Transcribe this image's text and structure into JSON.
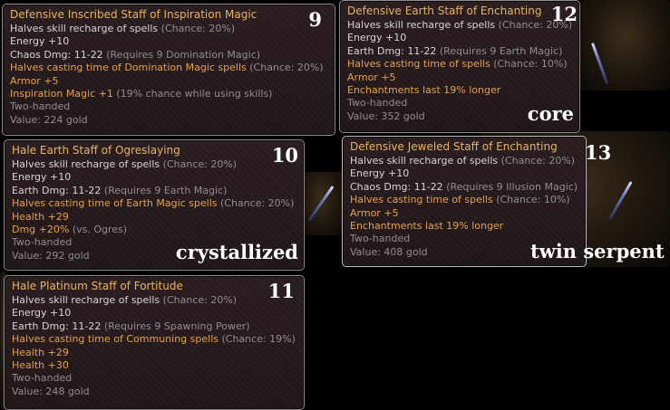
{
  "tooltips": [
    {
      "number": "9",
      "caption": "",
      "lines": [
        {
          "parts": [
            {
              "text": "Defensive Inscribed Staff of Inspiration Magic",
              "color": "title"
            }
          ]
        },
        {
          "parts": [
            {
              "text": "Halves skill recharge of spells ",
              "color": "white"
            },
            {
              "text": "(Chance: 20%)",
              "color": "grey"
            }
          ]
        },
        {
          "parts": [
            {
              "text": "Energy +10",
              "color": "white"
            }
          ]
        },
        {
          "parts": [
            {
              "text": "Chaos Dmg: 11-22 ",
              "color": "white"
            },
            {
              "text": "(Requires 9 Domination Magic)",
              "color": "grey"
            }
          ]
        },
        {
          "parts": [
            {
              "text": "Halves casting time of Domination Magic spells ",
              "color": "orange"
            },
            {
              "text": "(Chance: 20%)",
              "color": "grey"
            }
          ]
        },
        {
          "parts": [
            {
              "text": "Armor +5",
              "color": "orange"
            }
          ]
        },
        {
          "parts": [
            {
              "text": "Inspiration Magic +1 ",
              "color": "orange"
            },
            {
              "text": "(19% chance while using skills)",
              "color": "grey"
            }
          ]
        },
        {
          "parts": [
            {
              "text": "Two-handed",
              "color": "grey"
            }
          ]
        },
        {
          "parts": [
            {
              "text": "Value: 224 gold",
              "color": "grey"
            }
          ]
        }
      ]
    },
    {
      "number": "10",
      "caption": "crystallized",
      "lines": [
        {
          "parts": [
            {
              "text": "Hale Earth Staff of Ogreslaying",
              "color": "title"
            }
          ]
        },
        {
          "parts": [
            {
              "text": "Halves skill recharge of spells ",
              "color": "white"
            },
            {
              "text": "(Chance: 20%)",
              "color": "grey"
            }
          ]
        },
        {
          "parts": [
            {
              "text": "Energy +10",
              "color": "white"
            }
          ]
        },
        {
          "parts": [
            {
              "text": "Earth Dmg: 11-22 ",
              "color": "white"
            },
            {
              "text": "(Requires 9 Earth Magic)",
              "color": "grey"
            }
          ]
        },
        {
          "parts": [
            {
              "text": "Halves casting time of Earth Magic spells ",
              "color": "orange"
            },
            {
              "text": "(Chance: 20%)",
              "color": "grey"
            }
          ]
        },
        {
          "parts": [
            {
              "text": "Health +29",
              "color": "orange"
            }
          ]
        },
        {
          "parts": [
            {
              "text": "Dmg +20% ",
              "color": "orange"
            },
            {
              "text": "(vs. Ogres)",
              "color": "grey"
            }
          ]
        },
        {
          "parts": [
            {
              "text": "Two-handed",
              "color": "grey"
            }
          ]
        },
        {
          "parts": [
            {
              "text": "Value: 292 gold",
              "color": "grey"
            }
          ]
        }
      ]
    },
    {
      "number": "11",
      "caption": "",
      "lines": [
        {
          "parts": [
            {
              "text": "Hale Platinum Staff of Fortitude",
              "color": "title"
            }
          ]
        },
        {
          "parts": [
            {
              "text": "Halves skill recharge of spells ",
              "color": "white"
            },
            {
              "text": "(Chance: 20%)",
              "color": "grey"
            }
          ]
        },
        {
          "parts": [
            {
              "text": "Energy +10",
              "color": "white"
            }
          ]
        },
        {
          "parts": [
            {
              "text": "Earth Dmg: 11-22 ",
              "color": "white"
            },
            {
              "text": "(Requires 9 Spawning Power)",
              "color": "grey"
            }
          ]
        },
        {
          "parts": [
            {
              "text": "Halves casting time of Communing spells ",
              "color": "orange"
            },
            {
              "text": "(Chance: 19%)",
              "color": "grey"
            }
          ]
        },
        {
          "parts": [
            {
              "text": "Health +29",
              "color": "orange"
            }
          ]
        },
        {
          "parts": [
            {
              "text": "Health +30",
              "color": "orange"
            }
          ]
        },
        {
          "parts": [
            {
              "text": "Two-handed",
              "color": "grey"
            }
          ]
        },
        {
          "parts": [
            {
              "text": "Value: 248 gold",
              "color": "grey"
            }
          ]
        }
      ]
    },
    {
      "number": "12",
      "caption": "core",
      "lines": [
        {
          "parts": [
            {
              "text": "Defensive Earth Staff of Enchanting",
              "color": "title"
            }
          ]
        },
        {
          "parts": [
            {
              "text": "Halves skill recharge of spells ",
              "color": "white"
            },
            {
              "text": "(Chance: 20%)",
              "color": "grey"
            }
          ]
        },
        {
          "parts": [
            {
              "text": "Energy +10",
              "color": "white"
            }
          ]
        },
        {
          "parts": [
            {
              "text": "Earth Dmg: 11-22 ",
              "color": "white"
            },
            {
              "text": "(Requires 9 Earth Magic)",
              "color": "grey"
            }
          ]
        },
        {
          "parts": [
            {
              "text": "Halves casting time of spells ",
              "color": "orange"
            },
            {
              "text": "(Chance: 10%)",
              "color": "grey"
            }
          ]
        },
        {
          "parts": [
            {
              "text": "Armor +5",
              "color": "orange"
            }
          ]
        },
        {
          "parts": [
            {
              "text": "Enchantments last 19% longer",
              "color": "orange"
            }
          ]
        },
        {
          "parts": [
            {
              "text": "Two-handed",
              "color": "grey"
            }
          ]
        },
        {
          "parts": [
            {
              "text": "Value: 352 gold",
              "color": "grey"
            }
          ]
        }
      ]
    },
    {
      "number": "13",
      "caption": "twin serpent",
      "lines": [
        {
          "parts": [
            {
              "text": "Defensive Jeweled Staff of Enchanting",
              "color": "title"
            }
          ]
        },
        {
          "parts": [
            {
              "text": "Halves skill recharge of spells ",
              "color": "white"
            },
            {
              "text": "(Chance: 20%)",
              "color": "grey"
            }
          ]
        },
        {
          "parts": [
            {
              "text": "Energy +10",
              "color": "white"
            }
          ]
        },
        {
          "parts": [
            {
              "text": "Chaos Dmg: 11-22 ",
              "color": "white"
            },
            {
              "text": "(Requires 9 Illusion Magic)",
              "color": "grey"
            }
          ]
        },
        {
          "parts": [
            {
              "text": "Halves casting time of spells ",
              "color": "orange"
            },
            {
              "text": "(Chance: 10%)",
              "color": "grey"
            }
          ]
        },
        {
          "parts": [
            {
              "text": "Armor +5",
              "color": "orange"
            }
          ]
        },
        {
          "parts": [
            {
              "text": "Enchantments last 19% longer",
              "color": "orange"
            }
          ]
        },
        {
          "parts": [
            {
              "text": "Two-handed",
              "color": "grey"
            }
          ]
        },
        {
          "parts": [
            {
              "text": "Value: 408 gold",
              "color": "grey"
            }
          ]
        }
      ]
    }
  ],
  "colors": {
    "title": "#e8b561",
    "white": "#d6d6d6",
    "orange": "#e6a24a",
    "grey": "#8f8f8f",
    "number": "#ffffff"
  }
}
